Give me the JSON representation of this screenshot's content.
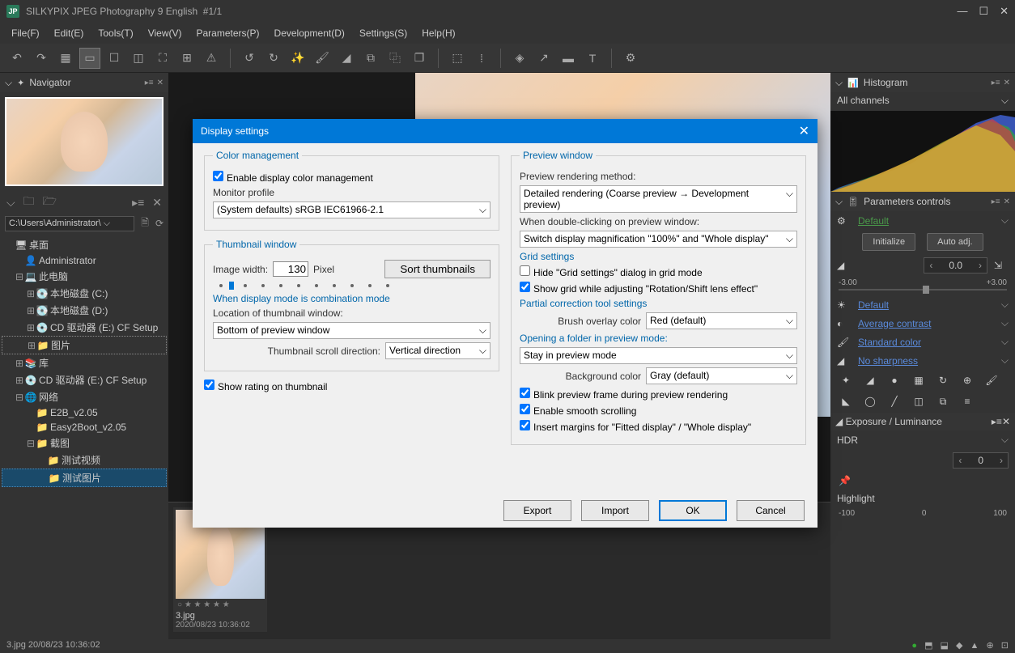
{
  "titlebar": {
    "app": "SILKYPIX JPEG Photography 9 English",
    "doc": "#1/1"
  },
  "menu": [
    "File(F)",
    "Edit(E)",
    "Tools(T)",
    "View(V)",
    "Parameters(P)",
    "Development(D)",
    "Settings(S)",
    "Help(H)"
  ],
  "left": {
    "navigator": "Navigator",
    "path": "C:\\Users\\Administrator\\",
    "tree": [
      {
        "tw": "",
        "icon": "🖥",
        "label": "桌面",
        "ind": 0
      },
      {
        "tw": "",
        "icon": "👤",
        "label": "Administrator",
        "ind": 1
      },
      {
        "tw": "⊟",
        "icon": "💻",
        "label": "此电脑",
        "ind": 1
      },
      {
        "tw": "⊞",
        "icon": "💽",
        "label": "本地磁盘 (C:)",
        "ind": 2
      },
      {
        "tw": "⊞",
        "icon": "💽",
        "label": "本地磁盘 (D:)",
        "ind": 2
      },
      {
        "tw": "⊞",
        "icon": "💿",
        "label": "CD 驱动器 (E:) CF Setup",
        "ind": 2
      },
      {
        "tw": "⊞",
        "icon": "📁",
        "label": "图片",
        "ind": 2,
        "dotted": true
      },
      {
        "tw": "⊞",
        "icon": "📚",
        "label": "库",
        "ind": 1
      },
      {
        "tw": "⊞",
        "icon": "💿",
        "label": "CD 驱动器 (E:) CF Setup",
        "ind": 1
      },
      {
        "tw": "⊟",
        "icon": "🌐",
        "label": "网络",
        "ind": 1
      },
      {
        "tw": "",
        "icon": "📁",
        "label": "E2B_v2.05",
        "ind": 2
      },
      {
        "tw": "",
        "icon": "📁",
        "label": "Easy2Boot_v2.05",
        "ind": 2
      },
      {
        "tw": "⊟",
        "icon": "📁",
        "label": "截图",
        "ind": 2
      },
      {
        "tw": "",
        "icon": "📁",
        "label": "测试视频",
        "ind": 3
      },
      {
        "tw": "",
        "icon": "📁",
        "label": "测试图片",
        "ind": 3,
        "sel": true
      }
    ]
  },
  "thumb": {
    "stars": "○ ★ ★ ★ ★ ★",
    "name": "3.jpg",
    "date": "2020/08/23 10:36:02"
  },
  "right": {
    "histogram": "Histogram",
    "channels": "All channels",
    "paramsctl": "Parameters controls",
    "default": "Default",
    "initialize": "Initialize",
    "autoadj": "Auto adj.",
    "ev_val": "0.0",
    "ev_min": "-3.00",
    "ev_max": "+3.00",
    "rows": [
      {
        "label": "Default"
      },
      {
        "label": "Average contrast"
      },
      {
        "label": "Standard color"
      },
      {
        "label": "No sharpness"
      }
    ],
    "expo_hdr": "Exposure / Luminance",
    "hdr": "HDR",
    "hdr_val": "0",
    "highlight": "Highlight",
    "hl_min": "-100",
    "hl_val": "0",
    "hl_max": "100"
  },
  "dialog": {
    "title": "Display settings",
    "cm": {
      "legend": "Color management",
      "enable": "Enable display color management",
      "monitor_label": "Monitor profile",
      "monitor_value": "(System defaults) sRGB IEC61966-2.1"
    },
    "tw": {
      "legend": "Thumbnail window",
      "imgw_label": "Image width:",
      "imgw_value": "130",
      "pixel": "Pixel",
      "sort": "Sort thumbnails",
      "combo_label": "When display mode is combination mode",
      "loc_label": "Location of thumbnail window:",
      "loc_value": "Bottom of preview window",
      "scroll_label": "Thumbnail scroll direction:",
      "scroll_value": "Vertical direction"
    },
    "show_rating": "Show rating on thumbnail",
    "pw": {
      "legend": "Preview window",
      "render_label": "Preview rendering method:",
      "render_value": "Detailed rendering (Coarse preview → Development preview)",
      "dbl_label": "When double-clicking on preview window:",
      "dbl_value": "Switch display magnification \"100%\" and \"Whole display\"",
      "grid_legend": "Grid settings",
      "hide_grid": "Hide \"Grid settings\" dialog in grid mode",
      "show_grid": "Show grid while adjusting \"Rotation/Shift lens effect\"",
      "partial_legend": "Partial correction tool settings",
      "brush_label": "Brush overlay color",
      "brush_value": "Red (default)",
      "open_label": "Opening a folder in preview mode:",
      "open_value": "Stay in preview mode",
      "bg_label": "Background color",
      "bg_value": "Gray (default)",
      "blink": "Blink preview frame during preview rendering",
      "smooth": "Enable smooth scrolling",
      "margins": "Insert margins for \"Fitted display\" / \"Whole display\""
    },
    "buttons": {
      "export": "Export",
      "import": "Import",
      "ok": "OK",
      "cancel": "Cancel"
    }
  },
  "status": "3.jpg 20/08/23 10:36:02"
}
